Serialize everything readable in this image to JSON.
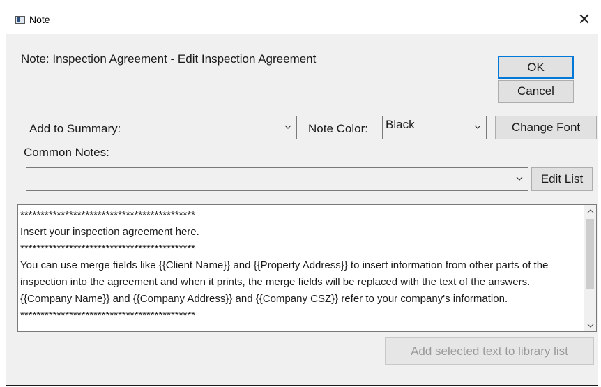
{
  "window": {
    "title": "Note",
    "close_glyph": "✕",
    "app_icon": "note-app-icon"
  },
  "heading": "Note: Inspection Agreement  - Edit Inspection Agreement",
  "buttons": {
    "ok": "OK",
    "cancel": "Cancel",
    "change_font": "Change Font",
    "edit_list": "Edit List",
    "add_to_library": "Add selected text to library list"
  },
  "summary": {
    "label": "Add to Summary:",
    "value": ""
  },
  "note_color": {
    "label": "Note Color:",
    "value": "Black"
  },
  "common_notes": {
    "label": "Common Notes:",
    "value": ""
  },
  "note_text": "*******************************************\nInsert your inspection agreement here.\n*******************************************\nYou can use merge fields like {{Client Name}} and {{Property Address}} to insert information from other parts of the inspection into the agreement and when it prints, the merge fields will be replaced with the text of the answers. {{Company Name}} and {{Company Address}} and {{Company CSZ}} refer to your company's information.\n*******************************************",
  "colors": {
    "accent": "#0078d7",
    "dialog_bg": "#f0f0f0",
    "disabled_text": "#9a9a9a"
  }
}
